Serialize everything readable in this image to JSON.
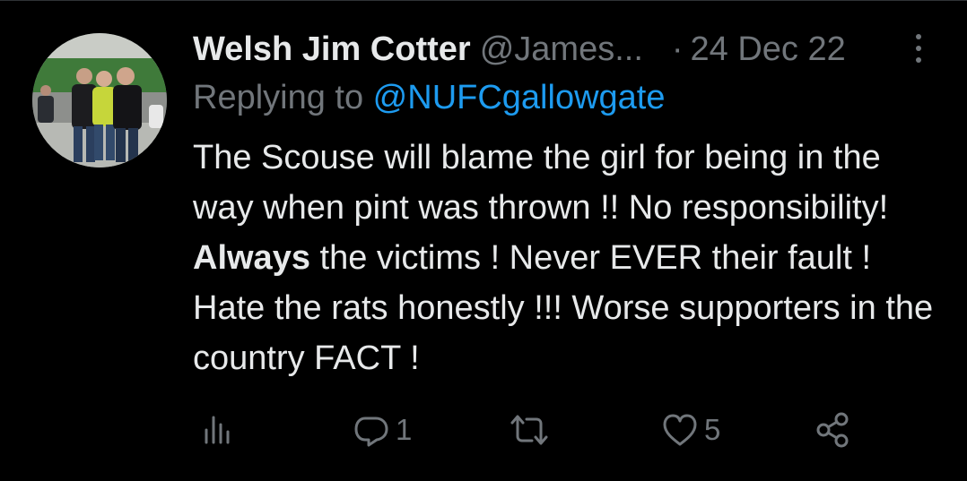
{
  "tweet": {
    "display_name": "Welsh Jim Cotter",
    "handle": "@James...",
    "separator": "·",
    "date": "24 Dec 22",
    "replying_prefix": "Replying to ",
    "replying_to": "@NUFCgallowgate",
    "text_before_bold": "The Scouse will blame the girl for being in the way when pint was thrown !! No responsibility! ",
    "text_bold": "Always",
    "text_after_bold": " the victims ! Never EVER their fault ! Hate the rats honestly !!! Worse supporters in the country FACT !"
  },
  "actions": {
    "views_icon": "analytics-icon",
    "reply_icon": "reply-icon",
    "reply_count": "1",
    "retweet_icon": "retweet-icon",
    "like_icon": "heart-icon",
    "like_count": "5",
    "share_icon": "share-icon"
  },
  "colors": {
    "background": "#000000",
    "text": "#e7e9ea",
    "muted": "#71767b",
    "link": "#1d9bf0"
  }
}
